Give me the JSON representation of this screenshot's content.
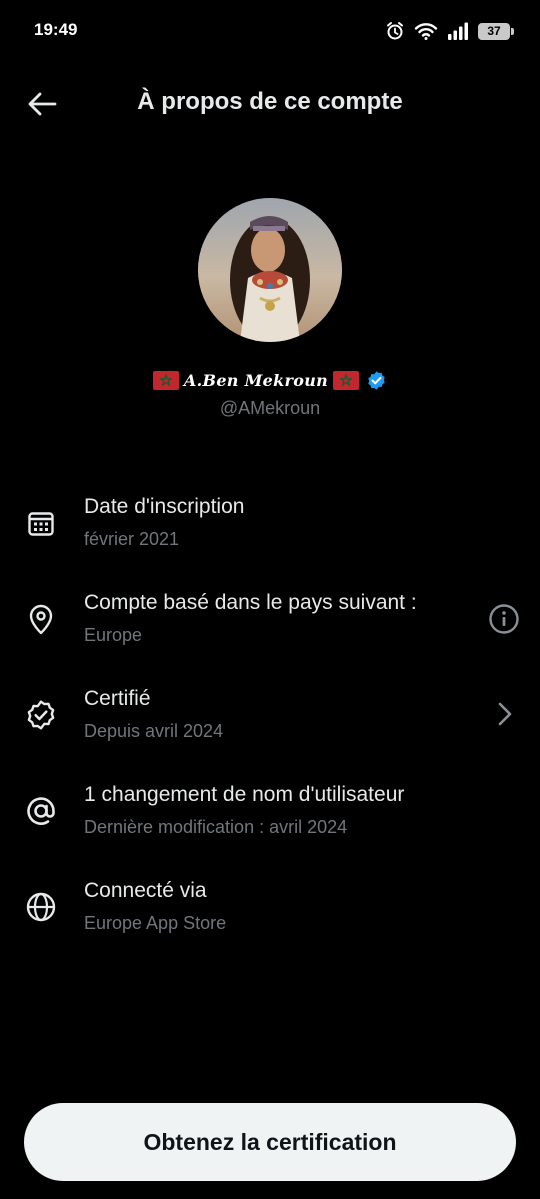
{
  "status_bar": {
    "time": "19:49",
    "battery_level": "37",
    "icons": [
      "alarm-icon",
      "wifi-icon",
      "signal-icon",
      "battery-icon"
    ]
  },
  "header": {
    "back_icon": "arrow-left-icon",
    "title": "À propos de ce compte"
  },
  "profile": {
    "display_name": "A.Ben Mekroun",
    "name_decoration_icon": "morocco-flag-icon",
    "verified_icon": "verified-badge-icon",
    "handle": "@AMekroun"
  },
  "info_rows": [
    {
      "icon": "calendar-icon",
      "title": "Date d'inscription",
      "subtitle": "février 2021"
    },
    {
      "icon": "location-pin-icon",
      "title": "Compte basé dans le pays suivant :",
      "subtitle": "Europe",
      "action_icon": "info-icon"
    },
    {
      "icon": "verified-check-icon",
      "title": "Certifié",
      "subtitle": "Depuis avril 2024",
      "action_icon": "chevron-right-icon"
    },
    {
      "icon": "at-sign-icon",
      "title": "1 changement de nom d'utilisateur",
      "subtitle": "Dernière modification : avril 2024"
    },
    {
      "icon": "globe-icon",
      "title": "Connecté via",
      "subtitle": "Europe App Store"
    }
  ],
  "cta": {
    "label": "Obtenez la certification"
  },
  "colors": {
    "background": "#000000",
    "primary_text": "#e7e9ea",
    "secondary_text": "#71767b",
    "verified_blue": "#1d9bf0",
    "flag_red": "#c1272d",
    "flag_green": "#006233",
    "button_bg": "#eff3f4"
  }
}
